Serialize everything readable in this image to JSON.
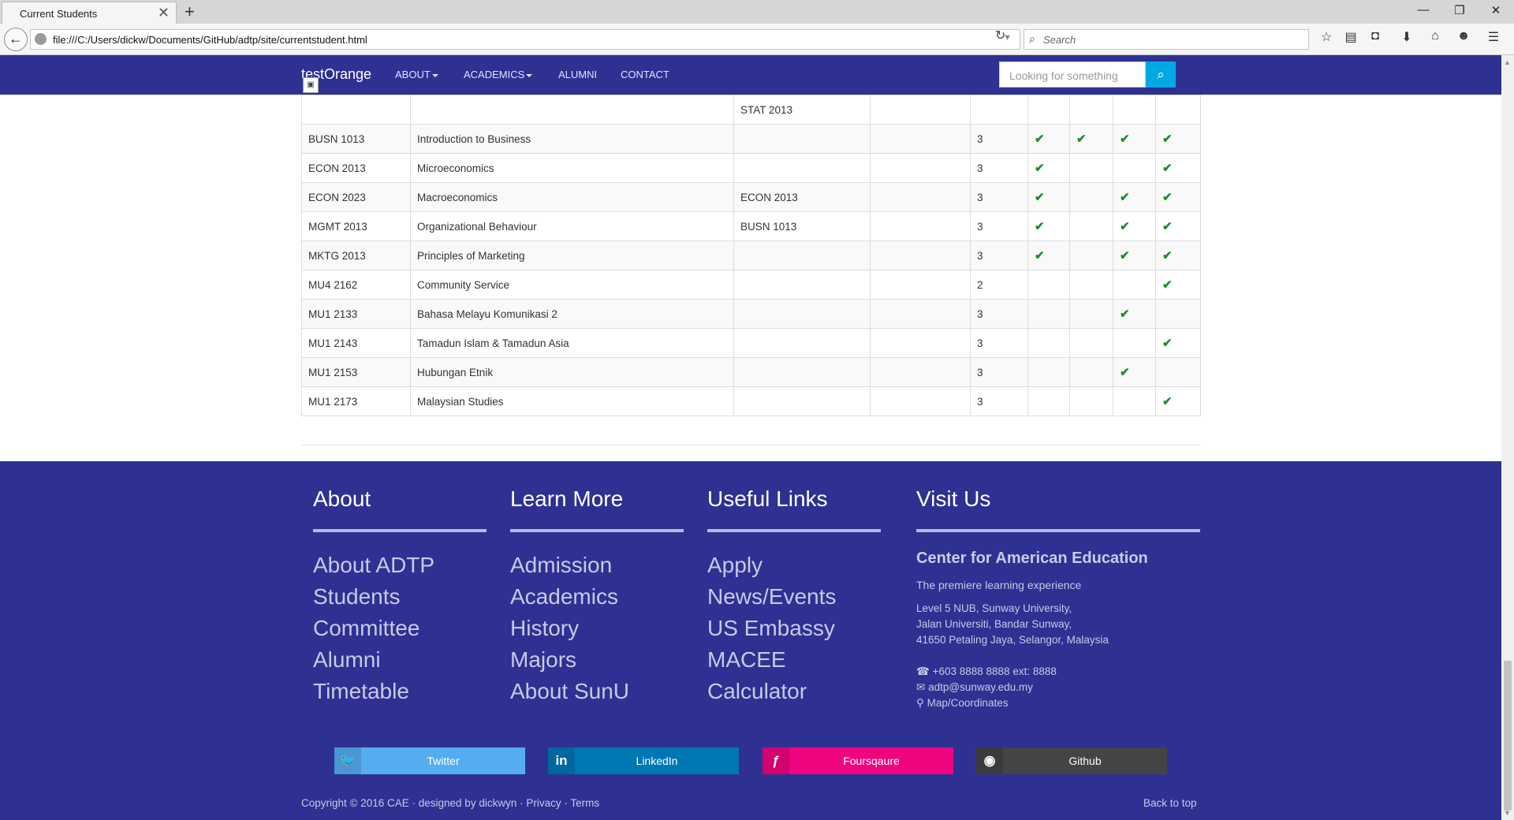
{
  "browser": {
    "tab_title": "Current Students",
    "url": "file:///C:/Users/dickw/Documents/GitHub/adtp/site/currentstudent.html",
    "search_placeholder": "Search"
  },
  "site_nav": {
    "brand": "testOrange",
    "links": [
      {
        "label": "ABOUT",
        "dropdown": true
      },
      {
        "label": "ACADEMICS",
        "dropdown": true
      },
      {
        "label": "ALUMNI",
        "dropdown": false
      },
      {
        "label": "CONTACT",
        "dropdown": false
      }
    ],
    "search_placeholder": "Looking for something"
  },
  "courses": {
    "partial_row_prereq": "STAT 2013",
    "rows": [
      {
        "code": "BUSN 1013",
        "name": "Introduction to Business",
        "prereq": "",
        "credits": "3",
        "checks": [
          true,
          true,
          true,
          true
        ]
      },
      {
        "code": "ECON 2013",
        "name": "Microeconomics",
        "prereq": "",
        "credits": "3",
        "checks": [
          true,
          false,
          false,
          true
        ]
      },
      {
        "code": "ECON 2023",
        "name": "Macroeconomics",
        "prereq": "ECON 2013",
        "credits": "3",
        "checks": [
          true,
          false,
          true,
          true
        ]
      },
      {
        "code": "MGMT 2013",
        "name": "Organizational Behaviour",
        "prereq": "BUSN 1013",
        "credits": "3",
        "checks": [
          true,
          false,
          true,
          true
        ]
      },
      {
        "code": "MKTG 2013",
        "name": "Principles of Marketing",
        "prereq": "",
        "credits": "3",
        "checks": [
          true,
          false,
          true,
          true
        ]
      },
      {
        "code": "MU4 2162",
        "name": "Community Service",
        "prereq": "",
        "credits": "2",
        "checks": [
          false,
          false,
          false,
          true
        ]
      },
      {
        "code": "MU1 2133",
        "name": "Bahasa Melayu Komunikasi 2",
        "prereq": "",
        "credits": "3",
        "checks": [
          false,
          false,
          true,
          false
        ]
      },
      {
        "code": "MU1 2143",
        "name": "Tamadun Islam & Tamadun Asia",
        "prereq": "",
        "credits": "3",
        "checks": [
          false,
          false,
          false,
          true
        ]
      },
      {
        "code": "MU1 2153",
        "name": "Hubungan Etnik",
        "prereq": "",
        "credits": "3",
        "checks": [
          false,
          false,
          true,
          false
        ]
      },
      {
        "code": "MU1 2173",
        "name": "Malaysian Studies",
        "prereq": "",
        "credits": "3",
        "checks": [
          false,
          false,
          false,
          true
        ]
      }
    ]
  },
  "footer": {
    "about": {
      "heading": "About",
      "links": [
        "About ADTP",
        "Students",
        "Committee",
        "Alumni",
        "Timetable"
      ]
    },
    "learn_more": {
      "heading": "Learn More",
      "links": [
        "Admission",
        "Academics",
        "History",
        "Majors",
        "About SunU"
      ]
    },
    "useful_links": {
      "heading": "Useful Links",
      "links": [
        "Apply",
        "News/Events",
        "US Embassy",
        "MACEE",
        "Calculator"
      ]
    },
    "visit": {
      "heading": "Visit Us",
      "org": "Center for American Education",
      "tagline": "The premiere learning experience",
      "address": [
        "Level 5 NUB, Sunway University,",
        "Jalan Universiti, Bandar Sunway,",
        "41650 Petaling Jaya, Selangor, Malaysia"
      ],
      "phone": "+603 8888 8888 ext: 8888",
      "email": "adtp@sunway.edu.my",
      "map": "Map/Coordinates"
    },
    "social": [
      {
        "label": "Twitter",
        "color": "#55acee"
      },
      {
        "label": "LinkedIn",
        "color": "#0077b5"
      },
      {
        "label": "Foursqaure",
        "color": "#f0047f"
      },
      {
        "label": "Github",
        "color": "#444444"
      }
    ],
    "copyright": "Copyright © 2016 CAE · designed by dickwyn · Privacy · Terms",
    "back_to_top": "Back to top"
  },
  "colors": {
    "nav_bg": "#2e3192",
    "search_btn": "#00a8e6",
    "check": "#1e8c2e"
  }
}
